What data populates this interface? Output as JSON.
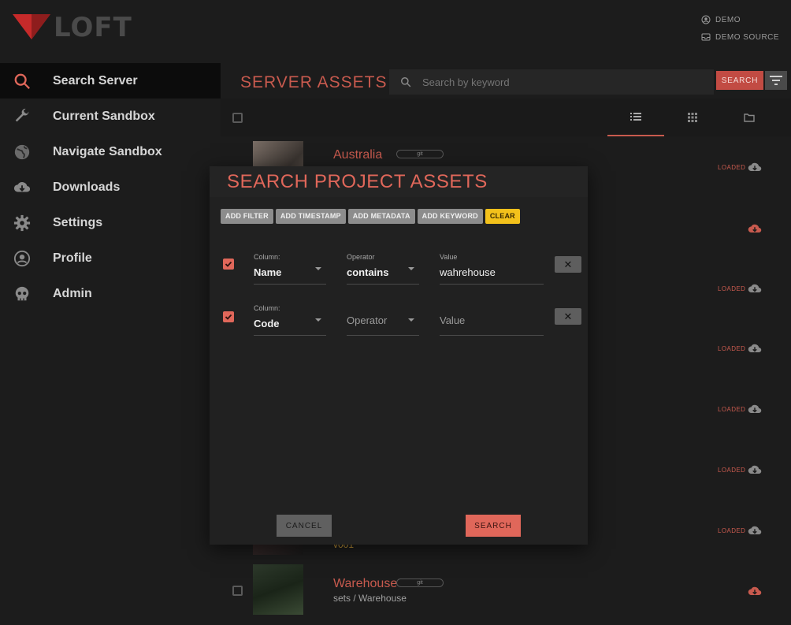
{
  "app": {
    "logo_text": "LOFT",
    "brand_color": "#c62a2a",
    "accent_color": "#e0675a"
  },
  "user": {
    "name": "DEMO",
    "source": "DEMO SOURCE"
  },
  "sidebar": {
    "items": [
      {
        "label": "Search Server",
        "icon": "search-icon",
        "active": true
      },
      {
        "label": "Current Sandbox",
        "icon": "wrench-icon"
      },
      {
        "label": "Navigate Sandbox",
        "icon": "globe-icon"
      },
      {
        "label": "Downloads",
        "icon": "cloud-download-icon"
      },
      {
        "label": "Settings",
        "icon": "gear-icon"
      },
      {
        "label": "Profile",
        "icon": "account-icon"
      },
      {
        "label": "Admin",
        "icon": "skull-icon"
      }
    ]
  },
  "main": {
    "title": "SERVER ASSETS",
    "search_placeholder": "Search by keyword",
    "search_button": "SEARCH",
    "assets": [
      {
        "name": "Australia",
        "tag": "git",
        "status": "LOADED"
      },
      {
        "status": ""
      },
      {
        "status": "LOADED"
      },
      {
        "status": "LOADED"
      },
      {
        "status": "LOADED"
      },
      {
        "status": "LOADED"
      },
      {
        "status": "LOADED",
        "sub": "v001"
      },
      {
        "name": "Warehouse",
        "tag": "git",
        "sub": "sets / Warehouse",
        "status": ""
      }
    ]
  },
  "dialog": {
    "title": "SEARCH PROJECT ASSETS",
    "chips": [
      "ADD FILTER",
      "ADD TIMESTAMP",
      "ADD METADATA",
      "ADD KEYWORD",
      "CLEAR"
    ],
    "filters": [
      {
        "column_label": "Column:",
        "column": "Name",
        "operator_label": "Operator",
        "operator": "contains",
        "value_label": "Value",
        "value": "wahrehouse"
      },
      {
        "column_label": "Column:",
        "column": "Code",
        "operator_placeholder": "Operator",
        "value_placeholder": "Value"
      }
    ],
    "cancel": "CANCEL",
    "submit": "SEARCH"
  }
}
